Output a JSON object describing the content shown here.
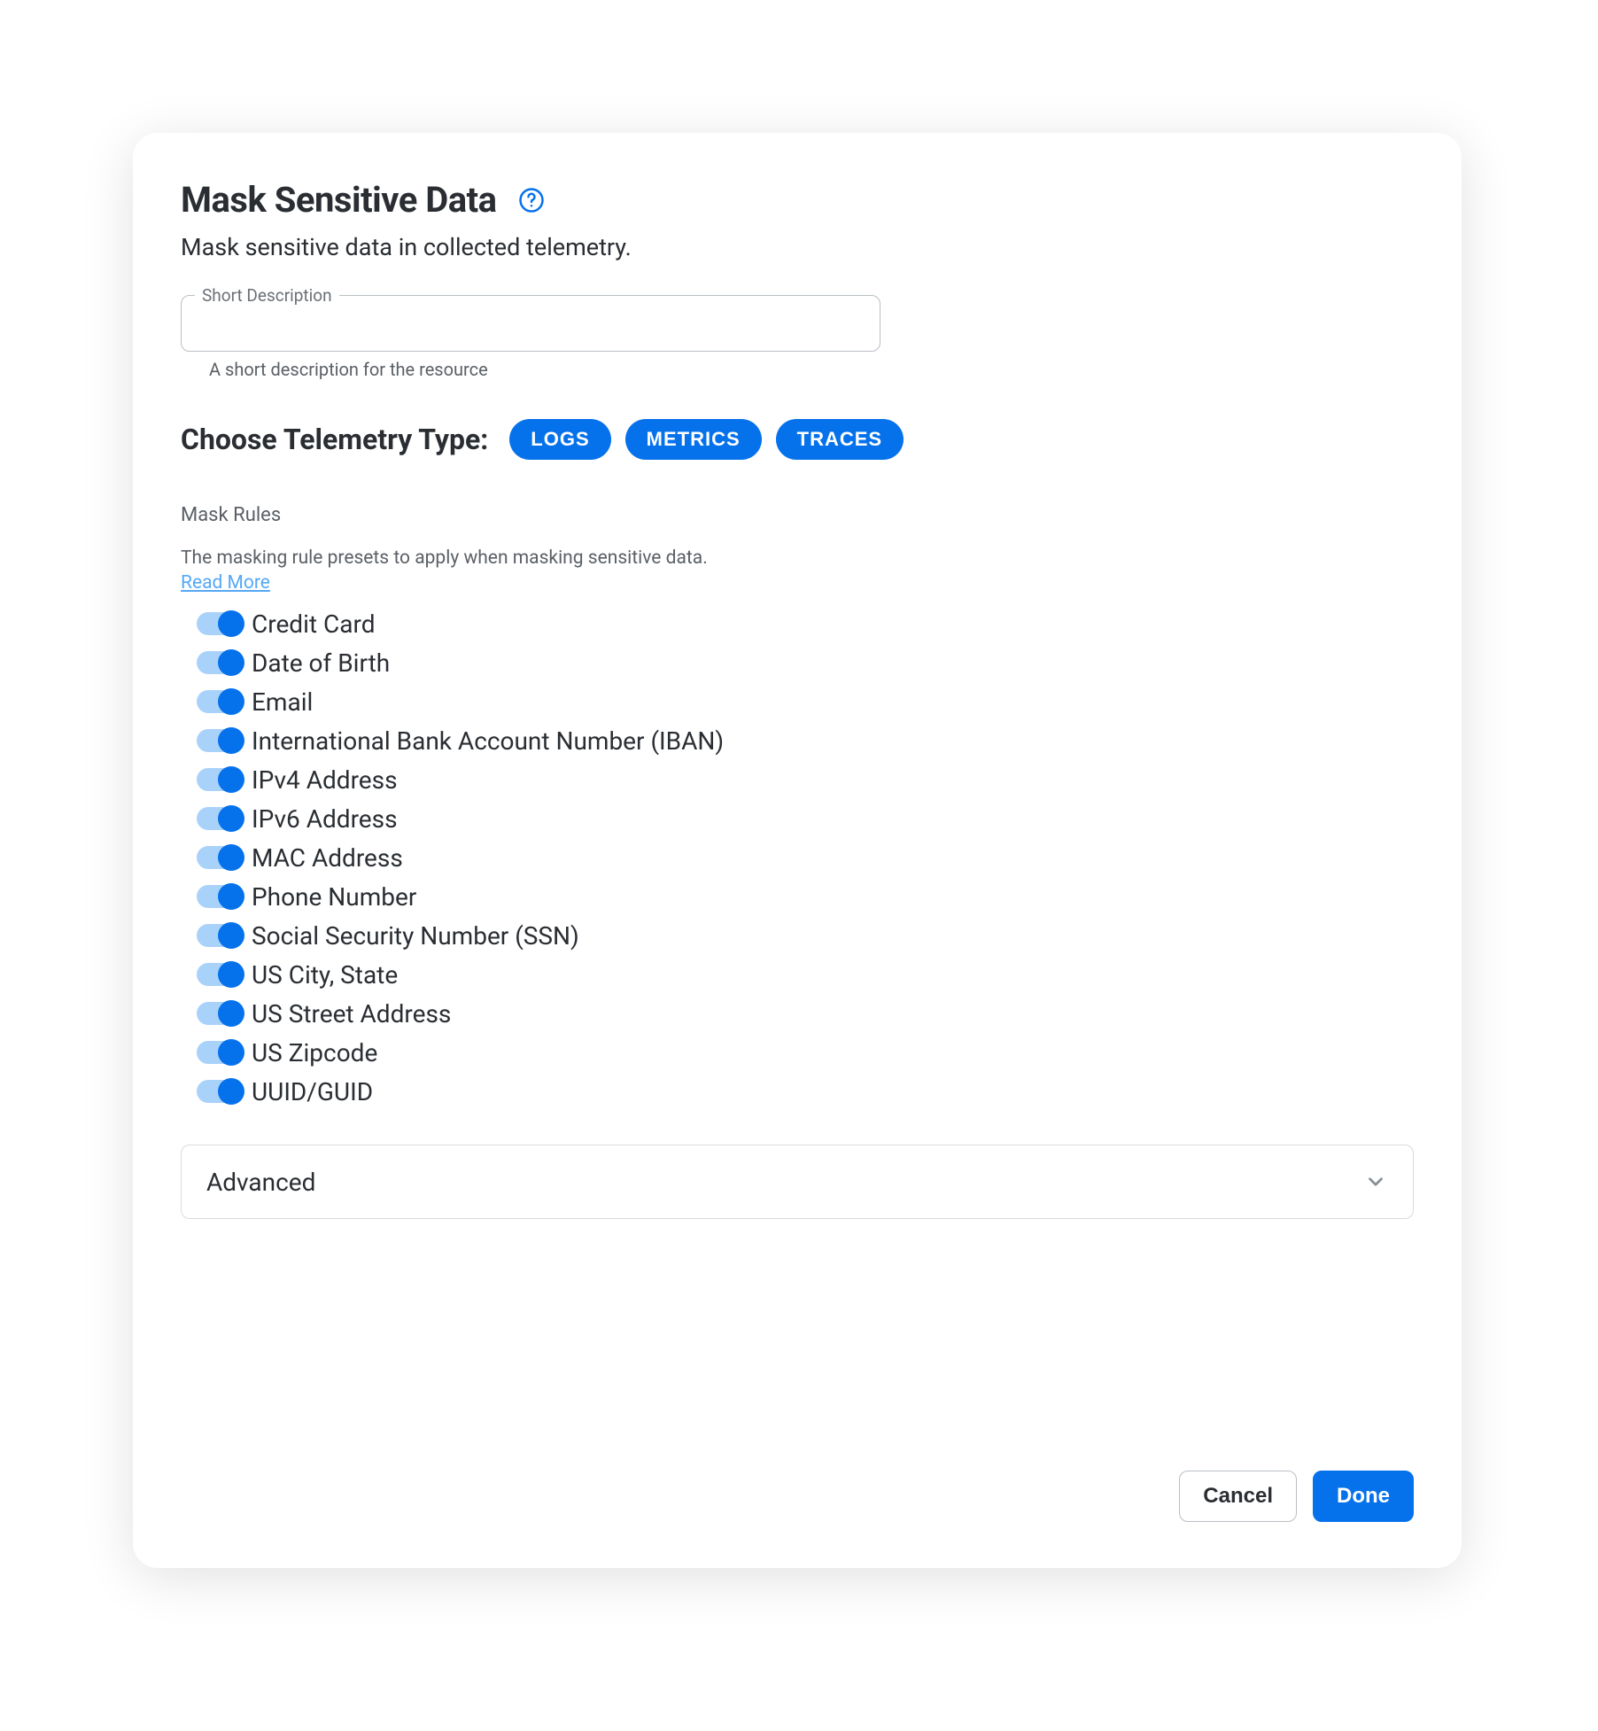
{
  "header": {
    "title": "Mask Sensitive Data",
    "subtitle": "Mask sensitive data in collected telemetry."
  },
  "shortDescription": {
    "label": "Short Description",
    "value": "",
    "helper": "A short description for the resource"
  },
  "telemetry": {
    "label": "Choose Telemetry Type:",
    "chips": [
      "LOGS",
      "METRICS",
      "TRACES"
    ]
  },
  "maskRules": {
    "title": "Mask Rules",
    "desc": "The masking rule presets to apply when masking sensitive data.",
    "readMore": "Read More",
    "items": [
      {
        "label": "Credit Card",
        "on": true
      },
      {
        "label": "Date of Birth",
        "on": true
      },
      {
        "label": "Email",
        "on": true
      },
      {
        "label": "International Bank Account Number (IBAN)",
        "on": true
      },
      {
        "label": "IPv4 Address",
        "on": true
      },
      {
        "label": "IPv6 Address",
        "on": true
      },
      {
        "label": "MAC Address",
        "on": true
      },
      {
        "label": "Phone Number",
        "on": true
      },
      {
        "label": "Social Security Number (SSN)",
        "on": true
      },
      {
        "label": "US City, State",
        "on": true
      },
      {
        "label": "US Street Address",
        "on": true
      },
      {
        "label": "US Zipcode",
        "on": true
      },
      {
        "label": "UUID/GUID",
        "on": true
      }
    ]
  },
  "advanced": {
    "label": "Advanced"
  },
  "footer": {
    "cancel": "Cancel",
    "done": "Done"
  },
  "colors": {
    "primary": "#0572ec",
    "toggleTrack": "#a9d2fb",
    "link": "#55a8f5"
  }
}
